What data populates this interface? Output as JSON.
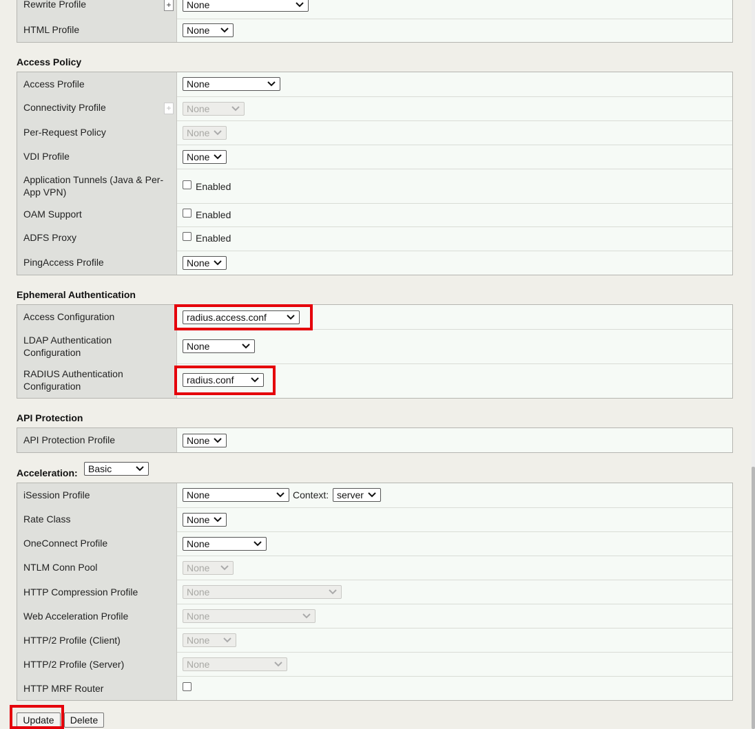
{
  "top_table": {
    "rewrite_label": "Rewrite Profile",
    "rewrite_plus": "+",
    "rewrite_value": "None",
    "html_label": "HTML Profile",
    "html_value": "None"
  },
  "access_policy": {
    "title": "Access Policy",
    "rows": [
      {
        "label": "Access Profile",
        "value": "None"
      },
      {
        "label": "Connectivity Profile",
        "value": "None",
        "plus": "+"
      },
      {
        "label": "Per-Request Policy",
        "value": "None"
      },
      {
        "label": "VDI Profile",
        "value": "None"
      },
      {
        "label_line1": "Application Tunnels (Java & Per-",
        "label_line2": "App VPN)",
        "checkbox_label": "Enabled"
      },
      {
        "label": "OAM Support",
        "checkbox_label": "Enabled"
      },
      {
        "label": "ADFS Proxy",
        "checkbox_label": "Enabled"
      },
      {
        "label": "PingAccess Profile",
        "value": "None"
      }
    ]
  },
  "ephemeral_auth": {
    "title": "Ephemeral Authentication",
    "rows": [
      {
        "label": "Access Configuration",
        "value": "radius.access.conf"
      },
      {
        "label_line1": "LDAP Authentication",
        "label_line2": "Configuration",
        "value": "None"
      },
      {
        "label_line1": "RADIUS Authentication",
        "label_line2": "Configuration",
        "value": "radius.conf"
      }
    ]
  },
  "api_protection": {
    "title": "API Protection",
    "rows": [
      {
        "label": "API Protection Profile",
        "value": "None"
      }
    ]
  },
  "acceleration": {
    "title": "Acceleration:",
    "mode_value": "Basic",
    "rows": [
      {
        "label": "iSession Profile",
        "value": "None",
        "context_label": "Context:",
        "context_value": "server"
      },
      {
        "label": "Rate Class",
        "value": "None"
      },
      {
        "label": "OneConnect Profile",
        "value": "None"
      },
      {
        "label": "NTLM Conn Pool",
        "value": "None"
      },
      {
        "label": "HTTP Compression Profile",
        "value": "None"
      },
      {
        "label": "Web Acceleration Profile",
        "value": "None"
      },
      {
        "label": "HTTP/2 Profile (Client)",
        "value": "None"
      },
      {
        "label": "HTTP/2 Profile (Server)",
        "value": "None"
      },
      {
        "label": "HTTP MRF Router"
      }
    ]
  },
  "buttons": {
    "update": "Update",
    "delete": "Delete"
  },
  "colors": {
    "highlight": "#e5000b",
    "label_bg": "#dfe0dc",
    "value_bg": "#f6faf6",
    "page_bg": "#f0efe9"
  }
}
